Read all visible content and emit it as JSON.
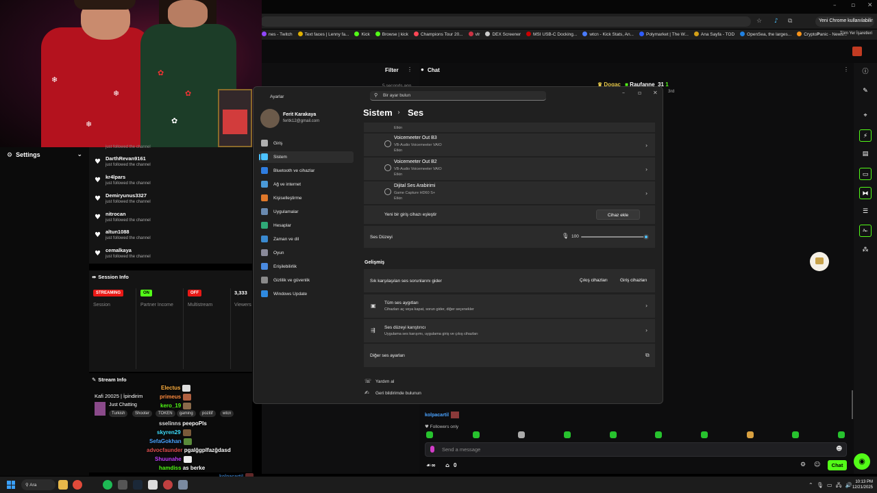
{
  "browser": {
    "profile_label": "Yeni Chrome kullanılabilir",
    "bookmarks": [
      {
        "label": "nes - Twitch",
        "color": "#9146ff"
      },
      {
        "label": "Text faces | Lenny fa...",
        "color": "#e0b000"
      },
      {
        "label": "Kick",
        "color": "#53fc18"
      },
      {
        "label": "Browse | kick",
        "color": "#53fc18"
      },
      {
        "label": "Champions Tour 20...",
        "color": "#ff4655"
      },
      {
        "label": "vlr",
        "color": "#cc3344"
      },
      {
        "label": "DEX Screener",
        "color": "#cccccc"
      },
      {
        "label": "MSI USB-C Docking...",
        "color": "#cc0000"
      },
      {
        "label": "wtcn - Kick Stats, An...",
        "color": "#4a7cff"
      },
      {
        "label": "Polymarket | The W...",
        "color": "#2e5cff"
      },
      {
        "label": "Ana Sayfa - TOD",
        "color": "#d4a017"
      },
      {
        "label": "OpenSea, the larges...",
        "color": "#2081e2"
      },
      {
        "label": "CryptoPanic - News...",
        "color": "#f7931a"
      }
    ],
    "bookmarks_more": "»",
    "all_bookmarks": "Tüm Yer İşaretleri"
  },
  "left_panel": {
    "settings_label": "Settings",
    "followers": [
      {
        "name": "DarthRevan9161",
        "sub": "just followed the channel"
      },
      {
        "name": "kr4lpars",
        "sub": "just followed the channel"
      },
      {
        "name": "Demiryunus3327",
        "sub": "just followed the channel"
      },
      {
        "name": "nitrocan",
        "sub": "just followed the channel"
      },
      {
        "name": "altun1088",
        "sub": "just followed the channel"
      },
      {
        "name": "cemalkaya",
        "sub": "just followed the channel"
      }
    ],
    "followers_partial_top": "just followed the channel",
    "session": {
      "title": "Session Info",
      "columns": [
        {
          "badge": "STREAMING",
          "badge_color": "#e91916",
          "label": "Session"
        },
        {
          "badge": "ON",
          "badge_color": "#53fc18",
          "label": "Partner Income"
        },
        {
          "badge": "OFF",
          "badge_color": "#e91916",
          "label": "Multistream"
        },
        {
          "badge": "3,333",
          "badge_color": "",
          "label": "Viewers"
        }
      ]
    },
    "stream": {
      "title": "Stream Info",
      "name": "Kafi 20025 | İpindirim",
      "game": "Just Chatting",
      "tags": [
        "Turkish",
        "Shooter",
        "TOKEN",
        "gaming",
        "pozitif",
        "wtcn"
      ]
    }
  },
  "overlay_chat": [
    {
      "user": "Electus",
      "msg": "",
      "color": "#ffb040"
    },
    {
      "user": "primeus",
      "msg": "",
      "color": "#ff8c40"
    },
    {
      "user": "kero_19",
      "msg": "",
      "color": "#53fc18"
    },
    {
      "user": "sselinns",
      "msg": "peepoPls",
      "color": "#dddddd"
    },
    {
      "user": "skyren29",
      "msg": "",
      "color": "#40e0ff"
    },
    {
      "user": "SefaGokhan",
      "msg": "",
      "color": "#4aa3ff"
    },
    {
      "user": "advocfaunder",
      "msg": "pgalğgplfazğdasd",
      "color": "#e05050"
    },
    {
      "user": "Shuunahe",
      "msg": "",
      "color": "#c040ff"
    },
    {
      "user": "hamdiss",
      "msg": "as berke",
      "color": "#53fc18"
    },
    {
      "user": "kolpacartil",
      "msg": "",
      "color": "#4aa3ff"
    }
  ],
  "middle": {
    "filter": "Filter",
    "time_ago": "5 seconds ago"
  },
  "chat": {
    "label": "Chat",
    "top_user_a": "Dogac",
    "top_user_b": "Raufanne_31",
    "top_user_c": "1",
    "top_meta": "3rd",
    "bottom_user": "kolpacartil",
    "followers_only": "Followers only",
    "send_placeholder": "Send a message",
    "footer_counts": "0",
    "chat_button": "Chat"
  },
  "settings_window": {
    "app_title": "Ayarlar",
    "search_placeholder": "Bir ayar bulun",
    "user_name": "Ferit Karakaya",
    "user_email": "feritk12@gmail.com",
    "nav": [
      {
        "label": "Giriş",
        "color": "#b0b0b0"
      },
      {
        "label": "Sistem",
        "color": "#4cc2ff"
      },
      {
        "label": "Bluetooth ve cihazlar",
        "color": "#2f7de0"
      },
      {
        "label": "Ağ ve internet",
        "color": "#4a9ad8"
      },
      {
        "label": "Kişiselleştirme",
        "color": "#e0782a"
      },
      {
        "label": "Uygulamalar",
        "color": "#6a8ab0"
      },
      {
        "label": "Hesaplar",
        "color": "#2faa78"
      },
      {
        "label": "Zaman ve dil",
        "color": "#3a8ad0"
      },
      {
        "label": "Oyun",
        "color": "#8a8a9a"
      },
      {
        "label": "Erişilebilirlik",
        "color": "#4a8ae0"
      },
      {
        "label": "Gizlilik ve güvenlik",
        "color": "#8a8a8a"
      },
      {
        "label": "Windows Update",
        "color": "#2f8ae0"
      }
    ],
    "breadcrumb_parent": "Sistem",
    "breadcrumb_sep": "›",
    "breadcrumb_current": "Ses",
    "devices_cut": "Etkin",
    "devices": [
      {
        "name": "Voicemeeter Out B3",
        "sub1": "VB-Audio Voicemeeter VAIO",
        "sub2": "Etkin"
      },
      {
        "name": "Voicemeeter Out B2",
        "sub1": "VB-Audio Voicemeeter VAIO",
        "sub2": "Etkin"
      },
      {
        "name": "Dijital Ses Arabirimi",
        "sub1": "Game Capture HD60 S+",
        "sub2": "Etkin"
      }
    ],
    "pair_label": "Yeni bir giriş cihazı eşleştir",
    "pair_button": "Cihaz ekle",
    "volume_label": "Ses Düzeyi",
    "volume_value": "100",
    "volume_fraction": 1.0,
    "advanced_title": "Gelişmiş",
    "troubleshoot_label": "Sık karşılaşılan ses sorunlarını gider",
    "output_button": "Çıkış cihazları",
    "input_button": "Giriş cihazları",
    "all_devices_title": "Tüm ses aygıtları",
    "all_devices_sub": "Cihazları aç veya kapat, sorun gider, diğer seçenekler",
    "mixer_title": "Ses düzeyi karıştırıcı",
    "mixer_sub": "Uygulama ses karışımı, uygulama giriş ve çıkış cihazları",
    "more_settings": "Diğer ses ayarları",
    "help": "Yardım al",
    "feedback": "Geri bildirimde bulunun"
  },
  "taskbar": {
    "search_label": "Ara",
    "time": "10:13 PM",
    "date": "12/21/2025"
  }
}
